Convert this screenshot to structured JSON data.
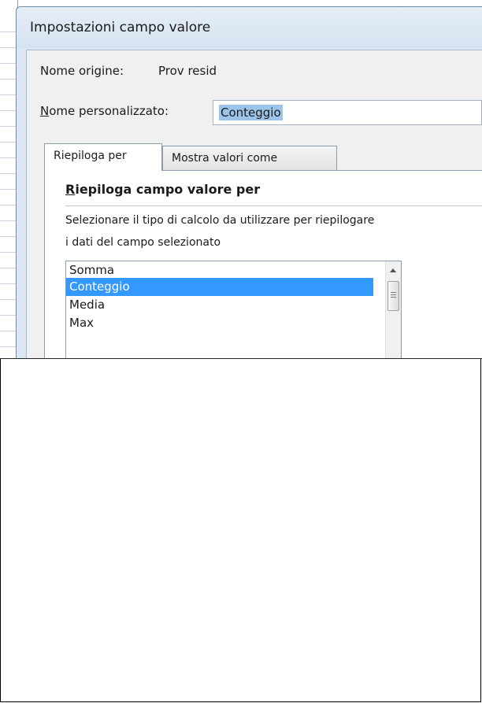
{
  "dialog": {
    "title": "Impostazioni campo valore",
    "source_label": "Nome origine:",
    "source_value": "Prov resid",
    "custom_name_label_underlined": "N",
    "custom_name_label_rest": "ome personalizzato:",
    "custom_name_value": "Conteggio"
  },
  "tabs": [
    {
      "label": "Riepiloga per",
      "active": true
    },
    {
      "label": "Mostra valori come",
      "active": false
    }
  ],
  "summary": {
    "section_title_underlined": "R",
    "section_title_rest": "iepiloga campo valore per",
    "description_line1": "Selezionare il tipo di calcolo da utilizzare per riepilogare",
    "description_line2": "i dati del campo selezionato"
  },
  "listbox": {
    "options": [
      "Somma",
      "Conteggio",
      "Media",
      "Max"
    ],
    "selected": "Conteggio",
    "selection_color": "#3399ff"
  },
  "icons": [
    "scroll-up-arrow-icon",
    "scroll-thumb-grip-icon"
  ]
}
